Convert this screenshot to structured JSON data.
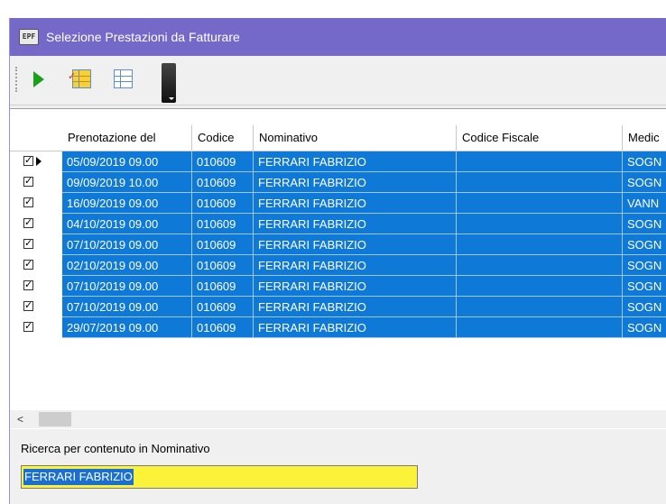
{
  "window": {
    "title": "Selezione Prestazioni da Fatturare",
    "icon": "app-icon"
  },
  "toolbar": {
    "buttons": [
      {
        "icon": "play-icon"
      },
      {
        "icon": "select-all-grid-icon"
      },
      {
        "icon": "grid-icon"
      },
      {
        "icon": "dark-dropdown-button"
      }
    ]
  },
  "grid": {
    "columns": [
      "Prenotazione del",
      "Codice",
      "Nominativo",
      "Codice Fiscale",
      "Medic"
    ],
    "rows": [
      {
        "checked": "✓",
        "prenotazione": "05/09/2019 09.00",
        "codice": "010609",
        "nominativo": "FERRARI FABRIZIO",
        "codice_fiscale": "",
        "medico": "SOGN"
      },
      {
        "checked": "✓",
        "prenotazione": "09/09/2019 10.00",
        "codice": "010609",
        "nominativo": "FERRARI FABRIZIO",
        "codice_fiscale": "",
        "medico": "SOGN"
      },
      {
        "checked": "✓",
        "prenotazione": "16/09/2019 09.00",
        "codice": "010609",
        "nominativo": "FERRARI FABRIZIO",
        "codice_fiscale": "",
        "medico": "VANN"
      },
      {
        "checked": "✓",
        "prenotazione": "04/10/2019 09.00",
        "codice": "010609",
        "nominativo": "FERRARI FABRIZIO",
        "codice_fiscale": "",
        "medico": "SOGN"
      },
      {
        "checked": "✓",
        "prenotazione": "07/10/2019 09.00",
        "codice": "010609",
        "nominativo": "FERRARI FABRIZIO",
        "codice_fiscale": "",
        "medico": "SOGN"
      },
      {
        "checked": "✓",
        "prenotazione": "02/10/2019 09.00",
        "codice": "010609",
        "nominativo": "FERRARI FABRIZIO",
        "codice_fiscale": "",
        "medico": "SOGN"
      },
      {
        "checked": "✓",
        "prenotazione": "07/10/2019 09.00",
        "codice": "010609",
        "nominativo": "FERRARI FABRIZIO",
        "codice_fiscale": "",
        "medico": "SOGN"
      },
      {
        "checked": "✓",
        "prenotazione": "07/10/2019 09.00",
        "codice": "010609",
        "nominativo": "FERRARI FABRIZIO",
        "codice_fiscale": "",
        "medico": "SOGN"
      },
      {
        "checked": "✓",
        "prenotazione": "29/07/2019 09.00",
        "codice": "010609",
        "nominativo": "FERRARI FABRIZIO",
        "codice_fiscale": "",
        "medico": "SOGN"
      }
    ],
    "scroll_left_glyph": "<"
  },
  "search": {
    "label": "Ricerca per contenuto in Nominativo",
    "value": "FERRARI FABRIZIO"
  },
  "colors": {
    "titlebar": "#7468c9",
    "selection": "#0f79d8",
    "search_bg": "#fbf23a"
  }
}
